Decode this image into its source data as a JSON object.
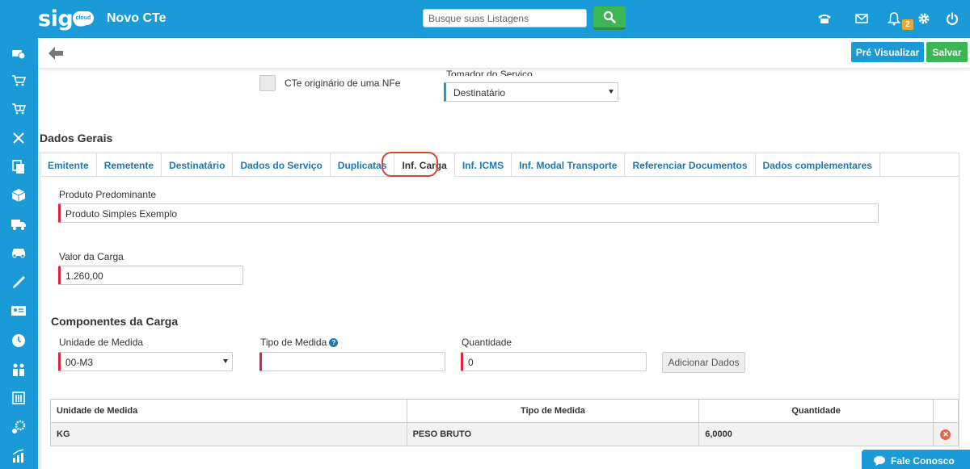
{
  "app": {
    "logo_text": "sige",
    "logo_badge": "cloud",
    "page_title": "Novo CTe"
  },
  "search": {
    "placeholder": "Busque suas Listagens"
  },
  "header_icons": [
    "phone-icon",
    "mail-icon",
    "bell-icon",
    "gear-icon",
    "power-icon"
  ],
  "notifications": {
    "count": "2"
  },
  "sidebar": {
    "items": [
      "money-icon",
      "cart-icon",
      "cart-add-icon",
      "tools-icon",
      "copy-icon",
      "box-icon",
      "truck-icon",
      "car-icon",
      "pen-icon",
      "id-card-icon",
      "clock-icon",
      "users-icon",
      "building-icon",
      "gears-icon",
      "chart-icon"
    ]
  },
  "toolbar": {
    "preview_label": "Pré Visualizar",
    "save_label": "Salvar"
  },
  "form_top": {
    "checkbox_label": "CTe originário de uma NFe",
    "tomador_label": "Tomador do Serviço",
    "tomador_value": "Destinatário"
  },
  "section_title": "Dados Gerais",
  "tabs": [
    {
      "label": "Emitente"
    },
    {
      "label": "Remetente"
    },
    {
      "label": "Destinatário"
    },
    {
      "label": "Dados do Serviço"
    },
    {
      "label": "Duplicatas"
    },
    {
      "label": "Inf. Carga"
    },
    {
      "label": "Inf. ICMS"
    },
    {
      "label": "Inf. Modal Transporte"
    },
    {
      "label": "Referenciar Documentos"
    },
    {
      "label": "Dados complementares"
    }
  ],
  "carga": {
    "produto_label": "Produto Predominante",
    "produto_value": "Produto Simples Exemplo",
    "valor_label": "Valor da Carga",
    "valor_value": "1.260,00"
  },
  "componentes": {
    "title": "Componentes da Carga",
    "unidade_label": "Unidade de Medida",
    "unidade_value": "00-M3",
    "tipo_label": "Tipo de Medida",
    "tipo_value": "",
    "quantidade_label": "Quantidade",
    "quantidade_value": "0",
    "add_button": "Adicionar Dados"
  },
  "table": {
    "headers": [
      "Unidade de Medida",
      "Tipo de Medida",
      "Quantidade"
    ],
    "rows": [
      [
        "KG",
        "PESO BRUTO",
        "6,0000"
      ]
    ]
  },
  "chat": {
    "label": "Fale Conosco"
  },
  "colors": {
    "primary": "#1a9ad6",
    "success": "#3cb554",
    "required": "#d9263b",
    "highlight": "#d9442e",
    "badge": "#f5a623"
  }
}
